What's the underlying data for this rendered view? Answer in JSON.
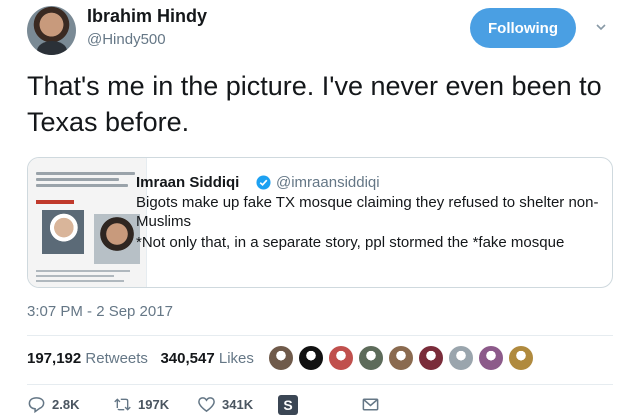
{
  "tweet": {
    "author_name": "Ibrahim Hindy",
    "author_handle": "@Hindy500",
    "follow_label": "Following",
    "text": "That's me in the picture. I've never even been to Texas before.",
    "timestamp": "3:07 PM - 2 Sep 2017"
  },
  "quote": {
    "author_name": "Imraan Siddiqi",
    "author_handle": "@imraansiddiqi",
    "text": "Bigots make up fake TX mosque claiming they refused to shelter non-Muslims",
    "text2": "*Not only that, in a separate story, ppl stormed the *fake mosque",
    "thumb_caption_1": "LMBRG Texas Mosque Refuses",
    "thumb_caption_2": "urricane Victims Shel",
    "thumb_caption_3": "ccupy Texas Mosque V",
    "thumb_caption_4": "efused To Help Christi"
  },
  "stats": {
    "retweets_count": "197,192",
    "retweets_label": "Retweets",
    "likes_count": "340,547",
    "likes_label": "Likes"
  },
  "likers": [
    "#6f5a4a",
    "#111111",
    "#c0504d",
    "#5d6b5a",
    "#8a6a4f",
    "#7a2c3a",
    "#9aa5ad",
    "#8c5a8a",
    "#b08a3e"
  ],
  "actions": {
    "reply_count": "2.8K",
    "retweet_count": "197K",
    "like_count": "341K",
    "badge_letter": "S"
  },
  "colors": {
    "accent": "#4a9fe3",
    "muted": "#657786"
  },
  "icons": [
    "caret-down-icon",
    "verified-icon",
    "reply-icon",
    "retweet-icon",
    "like-icon",
    "message-icon"
  ]
}
